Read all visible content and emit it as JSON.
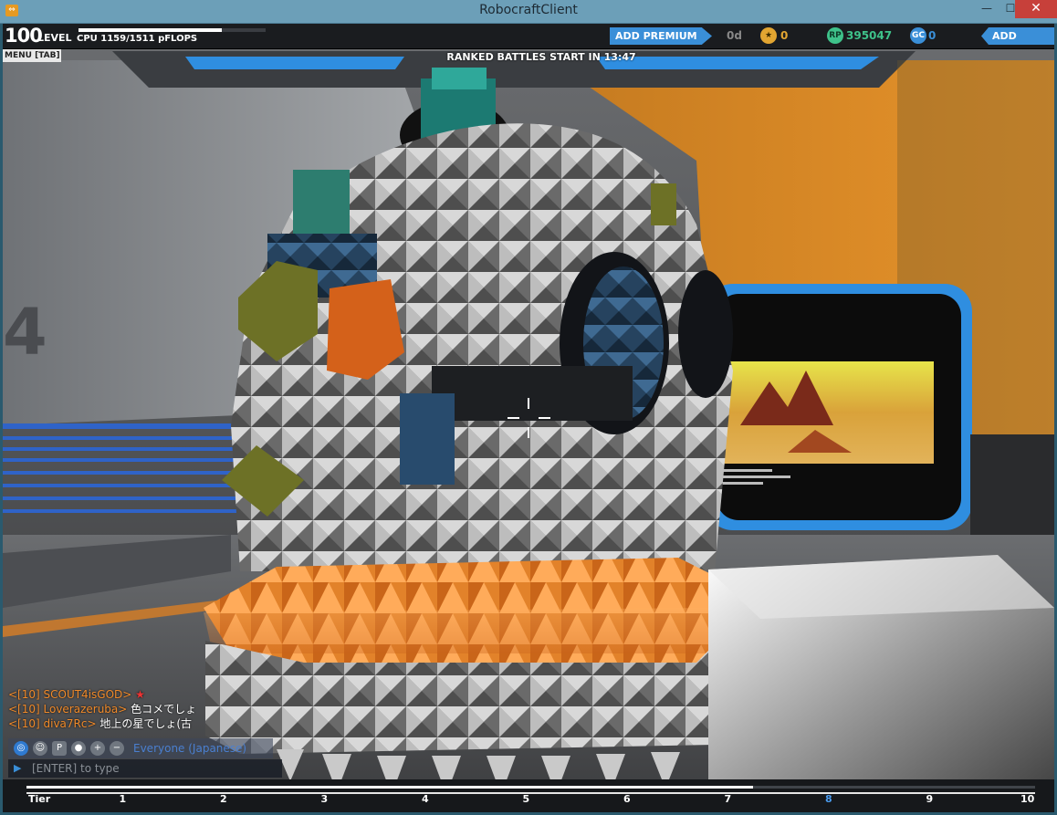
{
  "window": {
    "title": "RobocraftClient"
  },
  "hud": {
    "level": "100",
    "level_label": "LEVEL",
    "cpu_text": "CPU 1159/1511 pFLOPS",
    "cpu_fraction": 0.767,
    "premium_label": "ADD PREMIUM",
    "premium_days": "0d",
    "stars_value": "0",
    "rp_value": "395047",
    "gc_value": "0",
    "funds_label": "ADD FUNDS",
    "menu_label": "MENU [TAB]",
    "ranked_message": "RANKED BATTLES START IN 13:47"
  },
  "colors": {
    "accent_blue": "#3a8fd8",
    "robot_orange": "#f08a2a",
    "rp_green": "#3ec28a",
    "star_gold": "#e2a531"
  },
  "chat": {
    "lines": [
      {
        "name": "<[10] SCOUT4isGOD>",
        "msg": "★"
      },
      {
        "name": "<[10] Loverazeruba>",
        "msg": "色コメでしょ"
      },
      {
        "name": "<[10] diva7Rc>",
        "msg": "地上の星でしょ(古"
      }
    ],
    "channel": "Everyone (Japanese)",
    "input_placeholder": "[ENTER] to type",
    "icons": [
      "globe-icon",
      "person-icon",
      "party-icon",
      "friend-icon",
      "friend-add-icon",
      "friend-remove-icon"
    ]
  },
  "tier": {
    "label": "Tier",
    "ticks": [
      "1",
      "2",
      "3",
      "4",
      "5",
      "6",
      "7",
      "8",
      "9",
      "10"
    ],
    "active_tick": "8",
    "progress_fraction": 0.72
  },
  "scene_backdrop": {
    "wall_number": "4"
  }
}
